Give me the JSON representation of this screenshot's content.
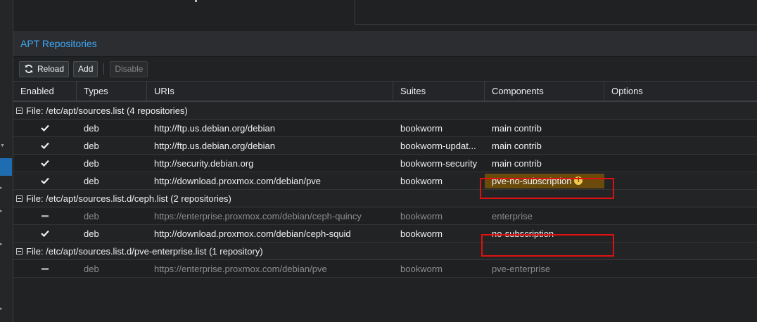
{
  "panel": {
    "title": "APT Repositories"
  },
  "toolbar": {
    "reload_label": "Reload",
    "add_label": "Add",
    "disable_label": "Disable"
  },
  "columns": {
    "enabled": "Enabled",
    "types": "Types",
    "uris": "URIs",
    "suites": "Suites",
    "components": "Components",
    "options": "Options"
  },
  "groups": [
    {
      "label": "File: /etc/apt/sources.list (4 repositories)",
      "rows": [
        {
          "enabled": true,
          "type": "deb",
          "uri": "http://ftp.us.debian.org/debian",
          "suite": "bookworm",
          "components": "main contrib"
        },
        {
          "enabled": true,
          "type": "deb",
          "uri": "http://ftp.us.debian.org/debian",
          "suite": "bookworm-updat...",
          "components": "main contrib"
        },
        {
          "enabled": true,
          "type": "deb",
          "uri": "http://security.debian.org",
          "suite": "bookworm-security",
          "components": "main contrib"
        },
        {
          "enabled": true,
          "type": "deb",
          "uri": "http://download.proxmox.com/debian/pve",
          "suite": "bookworm",
          "components": "pve-no-subscription",
          "warning": true
        }
      ]
    },
    {
      "label": "File: /etc/apt/sources.list.d/ceph.list (2 repositories)",
      "rows": [
        {
          "enabled": false,
          "type": "deb",
          "uri": "https://enterprise.proxmox.com/debian/ceph-quincy",
          "suite": "bookworm",
          "components": "enterprise"
        },
        {
          "enabled": true,
          "type": "deb",
          "uri": "http://download.proxmox.com/debian/ceph-squid",
          "suite": "bookworm",
          "components": "no-subscription"
        }
      ]
    },
    {
      "label": "File: /etc/apt/sources.list.d/pve-enterprise.list (1 repository)",
      "rows": [
        {
          "enabled": false,
          "type": "deb",
          "uri": "https://enterprise.proxmox.com/debian/pve",
          "suite": "bookworm",
          "components": "pve-enterprise"
        }
      ]
    }
  ],
  "colors": {
    "accent": "#3fa9f5",
    "warning_bg": "#6a4b0c",
    "highlight_box": "#e01010"
  },
  "icons": {
    "reload": "reload-icon",
    "enabled": "check-icon",
    "disabled": "dash-icon",
    "warning": "warning-icon",
    "collapse": "collapse-minus-icon"
  }
}
